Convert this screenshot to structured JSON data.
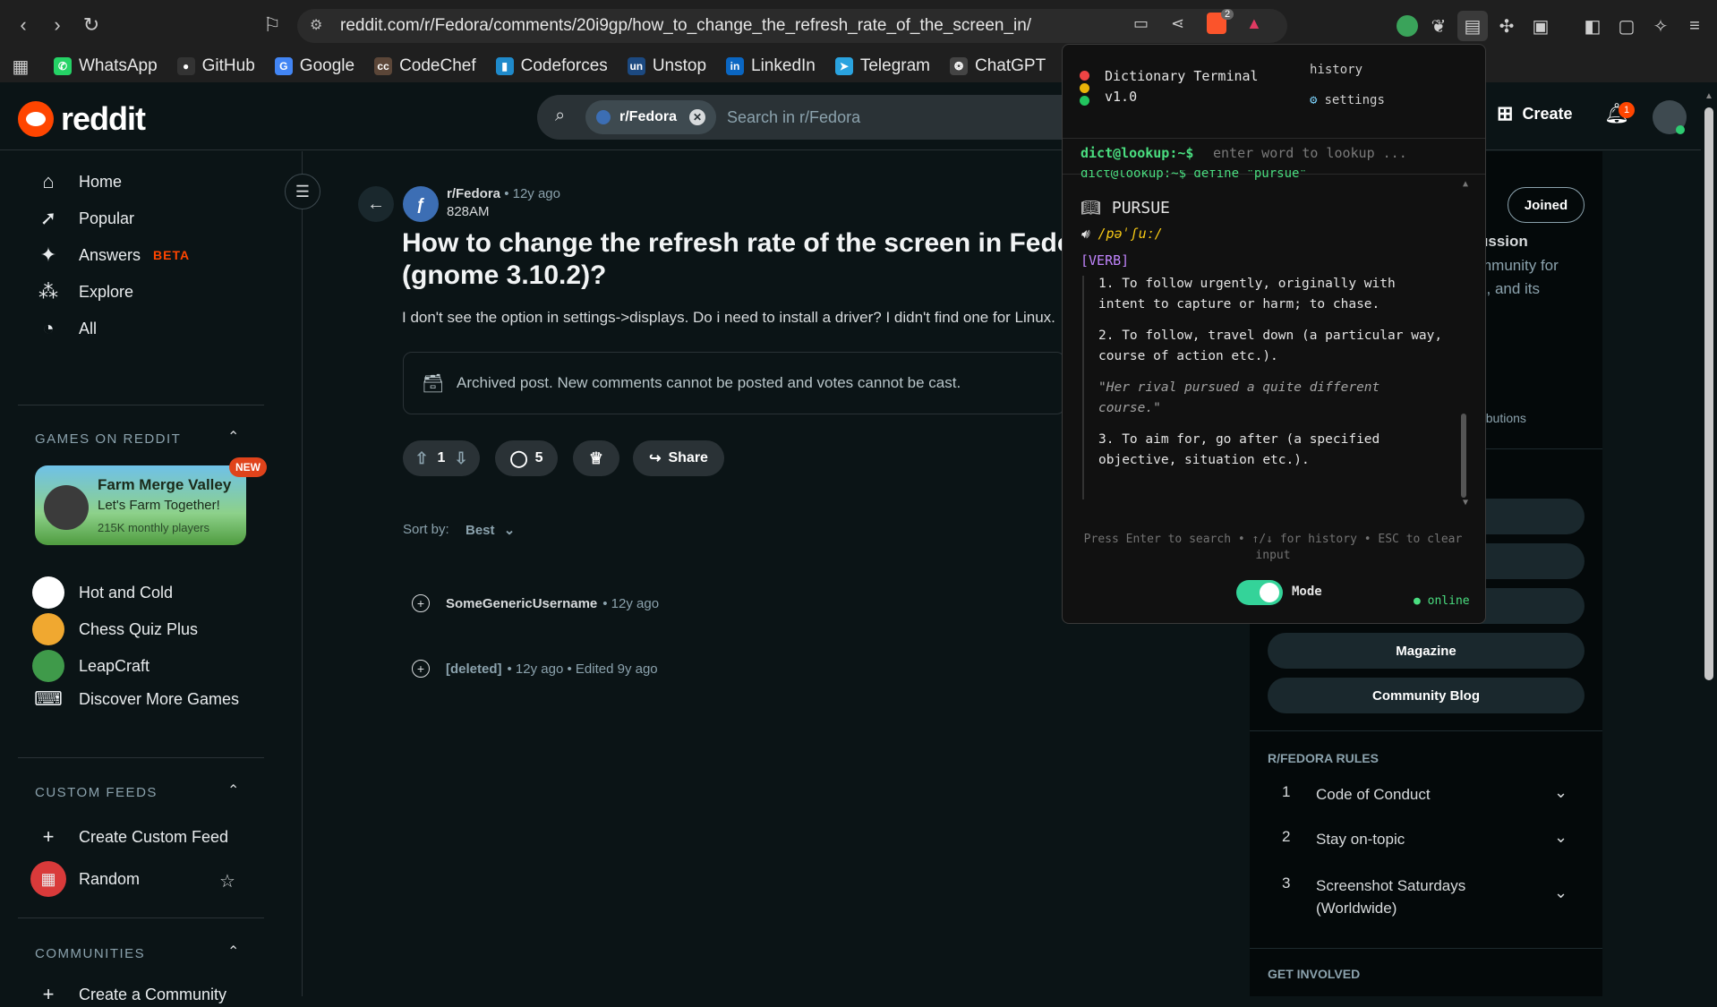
{
  "browser": {
    "url": "reddit.com/r/Fedora/comments/20i9gp/how_to_change_the_refresh_rate_of_the_screen_in/",
    "brave_badge": "2",
    "bookmarks": [
      {
        "label": "WhatsApp",
        "color": "#25d366",
        "glyph": "✆"
      },
      {
        "label": "GitHub",
        "color": "#333333",
        "glyph": "●"
      },
      {
        "label": "Google",
        "color": "#4285f4",
        "glyph": "G"
      },
      {
        "label": "CodeChef",
        "color": "#5b4638",
        "glyph": "cc"
      },
      {
        "label": "Codeforces",
        "color": "#1f8acb",
        "glyph": "▮"
      },
      {
        "label": "Unstop",
        "color": "#1c4980",
        "glyph": "un"
      },
      {
        "label": "LinkedIn",
        "color": "#0a66c2",
        "glyph": "in"
      },
      {
        "label": "Telegram",
        "color": "#2aa3df",
        "glyph": "➤"
      },
      {
        "label": "ChatGPT",
        "color": "#444444",
        "glyph": "❂"
      }
    ]
  },
  "header": {
    "logo_text": "reddit",
    "search_chip": "r/Fedora",
    "search_placeholder": "Search in r/Fedora",
    "create_label": "Create",
    "notification_count": "1"
  },
  "sidebar": {
    "nav": [
      {
        "label": "Home",
        "icon": "home-icon",
        "glyph": "⌂"
      },
      {
        "label": "Popular",
        "icon": "popular-icon",
        "glyph": "➚"
      },
      {
        "label": "Answers",
        "icon": "answers-icon",
        "glyph": "✦",
        "badge": "BETA"
      },
      {
        "label": "Explore",
        "icon": "explore-icon",
        "glyph": "⁂"
      },
      {
        "label": "All",
        "icon": "all-icon",
        "glyph": "◔"
      }
    ],
    "games_heading": "GAMES ON REDDIT",
    "featured_game": {
      "title": "Farm Merge Valley",
      "subtitle": "Let's Farm Together!",
      "players": "215K monthly players",
      "badge": "NEW"
    },
    "games": [
      {
        "label": "Hot and Cold",
        "color": "#ffffff"
      },
      {
        "label": "Chess Quiz Plus",
        "color": "#f0a830"
      },
      {
        "label": "LeapCraft",
        "color": "#3f9a4a"
      },
      {
        "label": "Discover More Games",
        "color": "#e9ecee"
      }
    ],
    "custom_feeds_heading": "CUSTOM FEEDS",
    "create_feed": "Create Custom Feed",
    "random": "Random",
    "communities_heading": "COMMUNITIES",
    "create_community": "Create a Community"
  },
  "post": {
    "subreddit": "r/Fedora",
    "age": "• 12y ago",
    "author": "828AM",
    "title_line1": "How to change the refresh rate of the screen in Fedora",
    "title_line2": "(gnome 3.10.2)?",
    "body": "I don't see the option in settings->displays. Do i need to install a driver? I didn't find one for Linux.",
    "archived_notice": "Archived post. New comments cannot be posted and votes cannot be cast.",
    "votes": "1",
    "comments": "5",
    "share": "Share",
    "sort_label": "Sort by:",
    "sort_value": "Best",
    "comment_list": [
      {
        "author": "SomeGenericUsername",
        "meta": "• 12y ago"
      },
      {
        "author": "[deleted]",
        "meta": "• 12y ago • Edited 9y ago"
      }
    ]
  },
  "right": {
    "joined": "Joined",
    "desc_title": "ussion",
    "desc_line1": "mmunity for",
    "desc_line2": "x, and its",
    "contrib": "ributions",
    "buttons": [
      "Magazine",
      "Community Blog"
    ],
    "rules_heading": "R/FEDORA RULES",
    "rules": [
      {
        "num": "1",
        "text": "Code of Conduct"
      },
      {
        "num": "2",
        "text": "Stay on-topic"
      },
      {
        "num": "3",
        "text": "Screenshot Saturdays (Worldwide)"
      }
    ],
    "get_involved": "GET INVOLVED"
  },
  "popup": {
    "title_line1": "Dictionary Terminal",
    "title_line2": "v1.0",
    "history": "history",
    "settings": "settings",
    "prompt": "dict@lookup:~$",
    "input_placeholder": "enter word to lookup ...",
    "previous_command": "dict@lookup:~$ define \"pursue\"",
    "word": "PURSUE",
    "pronunciation": "/pəˈʃuː/",
    "pos": "[VERB]",
    "def1": "1. To follow urgently, originally with intent to capture or harm; to chase.",
    "def2": "2. To follow, travel down (a particular way, course of action etc.).",
    "example": "\"Her rival pursued a quite different course.\"",
    "def3": "3. To aim for, go after (a specified objective, situation etc.).",
    "hint": "Press Enter to search • ↑/↓ for history • ESC to clear input",
    "mode_label": "Mode",
    "status": "● online",
    "colors": {
      "prompt": "#4ade80",
      "pos": "#c084fc",
      "accent": "#facc15"
    }
  }
}
